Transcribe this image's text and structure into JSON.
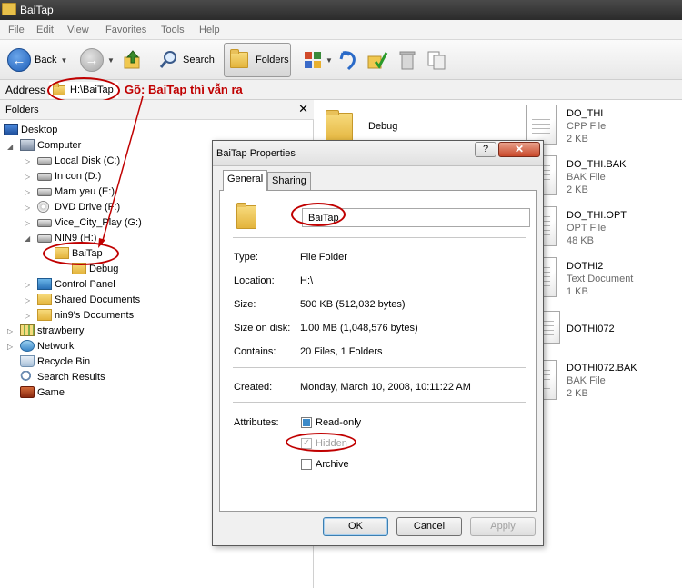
{
  "window": {
    "title": "BaiTap"
  },
  "menu": [
    "File",
    "Edit",
    "View",
    "Favorites",
    "Tools",
    "Help"
  ],
  "toolbar": {
    "back_label": "Back",
    "search_label": "Search",
    "folders_label": "Folders"
  },
  "address": {
    "label": "Address",
    "value": "H:\\BaiTap"
  },
  "annotation": {
    "text": "Gõ: BaiTap thì vẫn ra"
  },
  "folders_pane": {
    "title": "Folders",
    "close": "✕",
    "items": [
      {
        "label": "Desktop"
      },
      {
        "label": "Computer"
      },
      {
        "label": "Local Disk (C:)"
      },
      {
        "label": "In con (D:)"
      },
      {
        "label": "Mam yeu (E:)"
      },
      {
        "label": "DVD Drive (F:)"
      },
      {
        "label": "Vice_City_Play (G:)"
      },
      {
        "label": "NIN9 (H:)"
      },
      {
        "label": "BaiTap"
      },
      {
        "label": "Debug"
      },
      {
        "label": "Control Panel"
      },
      {
        "label": "Shared Documents"
      },
      {
        "label": "nin9's Documents"
      },
      {
        "label": "strawberry"
      },
      {
        "label": "Network"
      },
      {
        "label": "Recycle Bin"
      },
      {
        "label": "Search Results"
      },
      {
        "label": "Game"
      }
    ]
  },
  "files": [
    {
      "name": "Debug",
      "type": "",
      "size": ""
    },
    {
      "name": "DO_THI",
      "type": "CPP File",
      "size": "2 KB"
    },
    {
      "name": "DO_THI.BAK",
      "type": "BAK File",
      "size": "2 KB"
    },
    {
      "name": "DO_THI.OPT",
      "type": "OPT File",
      "size": "48 KB"
    },
    {
      "name": "DOTHI2",
      "type": "Text Document",
      "size": "1 KB"
    },
    {
      "name": "DOTHI072",
      "type": "",
      "size": ""
    },
    {
      "name": "DOTHI072.BAK",
      "type": "BAK File",
      "size": "2 KB"
    }
  ],
  "dialog": {
    "title": "BaiTap Properties",
    "help": "?",
    "close": "✕",
    "tabs": [
      "General",
      "Sharing"
    ],
    "name": "BaiTap",
    "rows": [
      {
        "label": "Type:",
        "value": "File Folder"
      },
      {
        "label": "Location:",
        "value": "H:\\"
      },
      {
        "label": "Size:",
        "value": "500 KB (512,032 bytes)"
      },
      {
        "label": "Size on disk:",
        "value": "1.00 MB (1,048,576 bytes)"
      },
      {
        "label": "Contains:",
        "value": "20 Files, 1 Folders"
      },
      {
        "label": "Created:",
        "value": "Monday, March 10, 2008, 10:11:22 AM"
      }
    ],
    "attributes_label": "Attributes:",
    "attributes": [
      {
        "label": "Read-only",
        "state": "partial"
      },
      {
        "label": "Hidden",
        "state": "checked-disabled"
      },
      {
        "label": "Archive",
        "state": "unchecked"
      }
    ],
    "buttons": {
      "ok": "OK",
      "cancel": "Cancel",
      "apply": "Apply"
    }
  }
}
